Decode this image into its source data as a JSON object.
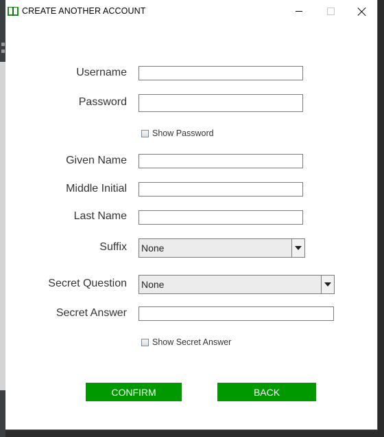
{
  "window": {
    "title": "CREATE ANOTHER ACCOUNT",
    "icon": "book-icon",
    "controls": [
      "minimize-icon",
      "maximize-icon",
      "close-icon"
    ]
  },
  "form": {
    "username": {
      "label": "Username",
      "value": ""
    },
    "password": {
      "label": "Password",
      "value": ""
    },
    "show_password": {
      "label": "Show Password",
      "checked": false
    },
    "given_name": {
      "label": "Given Name",
      "value": ""
    },
    "middle_initial": {
      "label": "Middle Initial",
      "value": ""
    },
    "last_name": {
      "label": "Last Name",
      "value": ""
    },
    "suffix": {
      "label": "Suffix",
      "selected": "None"
    },
    "secret_question": {
      "label": "Secret Question",
      "selected": "None"
    },
    "secret_answer": {
      "label": "Secret Answer",
      "value": ""
    },
    "show_secret_answer": {
      "label": "Show Secret Answer",
      "checked": false
    }
  },
  "buttons": {
    "confirm": "CONFIRM",
    "back": "BACK"
  },
  "colors": {
    "button_bg": "#009900",
    "button_text": "#ffffff",
    "label_text": "#333333"
  }
}
